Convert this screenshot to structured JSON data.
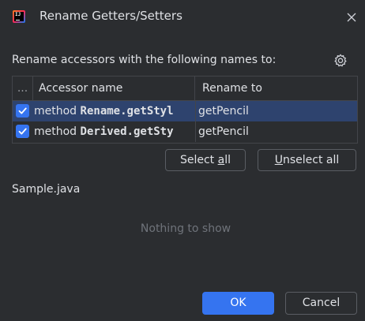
{
  "window": {
    "title": "Rename Getters/Setters",
    "app_icon_text": "IJ"
  },
  "header": {
    "subtitle": "Rename accessors with the following names to:"
  },
  "table": {
    "columns": {
      "check": "...",
      "accessor": "Accessor name",
      "rename": "Rename to"
    },
    "rows": [
      {
        "checked": true,
        "selected": true,
        "kind": "method",
        "accessor": "Rename.getStyl",
        "rename_to": "getPencil"
      },
      {
        "checked": true,
        "selected": false,
        "kind": "method",
        "accessor": "Derived.getSty",
        "rename_to": "getPencil"
      }
    ]
  },
  "buttons": {
    "select_all": {
      "mnemonic_prefix": "Select ",
      "mnemonic": "a",
      "rest": "ll"
    },
    "unselect_all": {
      "mnemonic_prefix": "",
      "mnemonic": "U",
      "rest": "nselect all"
    },
    "ok": "OK",
    "cancel": "Cancel"
  },
  "file_section": {
    "file_name": "Sample.java",
    "empty_text": "Nothing to show"
  },
  "colors": {
    "background": "#2b2d30",
    "accent": "#3574f0",
    "selection": "#2e436e",
    "border": "#43454a",
    "muted_text": "#6f737a"
  },
  "icons": {
    "app": "intellij-idea-icon",
    "close": "close-icon",
    "settings": "gear-icon",
    "checkbox": "checkmark-icon"
  }
}
